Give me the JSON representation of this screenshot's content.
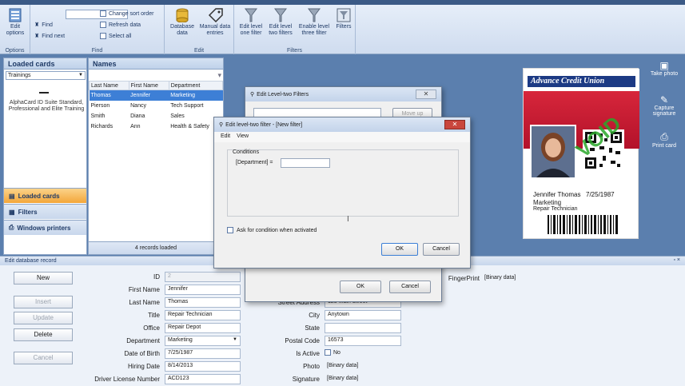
{
  "ribbon": {
    "groups": {
      "options": "Options",
      "find": "Find",
      "edit": "Edit",
      "filters": "Filters"
    },
    "edit_options": "Edit options",
    "find": "Find",
    "find_next": "Find next",
    "change_sort_order": "Change sort order",
    "refresh_data": "Refresh data",
    "select_all": "Select all",
    "database_data": "Database data",
    "manual_data_entries": "Manual data entries",
    "edit_level_one": "Edit level one filter",
    "edit_level_two": "Edit level two filters",
    "enable_level_three": "Enable level three filter",
    "filters": "Filters"
  },
  "loaded_cards": {
    "title": "Loaded cards",
    "selected": "Trainings",
    "card_desc": "AlphaCard ID Suite Standard, Professional and Elite Training",
    "nav": [
      "Loaded cards",
      "Filters",
      "Windows printers"
    ]
  },
  "names": {
    "title": "Names",
    "columns": [
      "Last Name",
      "First Name",
      "Department"
    ],
    "rows": [
      {
        "last": "Thomas",
        "first": "Jennifer",
        "dept": "Marketing"
      },
      {
        "last": "Pierson",
        "first": "Nancy",
        "dept": "Tech Support"
      },
      {
        "last": "Smith",
        "first": "Diana",
        "dept": "Sales"
      },
      {
        "last": "Richards",
        "first": "Ann",
        "dept": "Health & Safety"
      }
    ],
    "status": "4 records loaded"
  },
  "card": {
    "brand": "Advance Credit Union",
    "name": "Jennifer Thomas",
    "dob": "7/25/1987",
    "department": "Marketing",
    "title": "Repair Technician",
    "watermark": "VOID"
  },
  "side_tools": [
    "Take photo",
    "Capture signature",
    "Print card"
  ],
  "db_record": {
    "title": "Edit database record",
    "buttons": {
      "new": "New",
      "insert": "Insert",
      "update": "Update",
      "delete": "Delete",
      "cancel": "Cancel"
    },
    "labels": {
      "id": "ID",
      "first_name": "First Name",
      "last_name": "Last Name",
      "title": "Title",
      "office": "Office",
      "department": "Department",
      "dob": "Date of Birth",
      "hiring_date": "Hiring Date",
      "dl_number": "Driver License Number",
      "street": "Street Address",
      "city": "City",
      "state": "State",
      "postal": "Postal Code",
      "is_active": "Is Active",
      "photo": "Photo",
      "signature": "Signature",
      "fingerprint": "FingerPrint"
    },
    "values": {
      "id": "2",
      "first_name": "Jennifer",
      "last_name": "Thomas",
      "title": "Repair Technician",
      "office": "Repair Depot",
      "department": "Marketing",
      "dob": "7/25/1987",
      "hiring_date": "8/14/2013",
      "dl_number": "ACD123",
      "street": "123 Main Street",
      "city": "Anytown",
      "state": "",
      "postal": "16573",
      "is_active": "No",
      "photo": "[Binary data]",
      "signature": "[Binary data]",
      "fingerprint": "[Binary data]"
    }
  },
  "dialog_back": {
    "title": "Edit Level-two Filters",
    "move_up": "Move up",
    "ok": "OK",
    "cancel": "Cancel"
  },
  "dialog_front": {
    "title": "Edit level-two filter - [New filter]",
    "menu": [
      "Edit",
      "View"
    ],
    "conditions": "Conditions",
    "field": "[Department] =",
    "ask_label": "Ask for condition when activated",
    "ok": "OK",
    "cancel": "Cancel"
  }
}
